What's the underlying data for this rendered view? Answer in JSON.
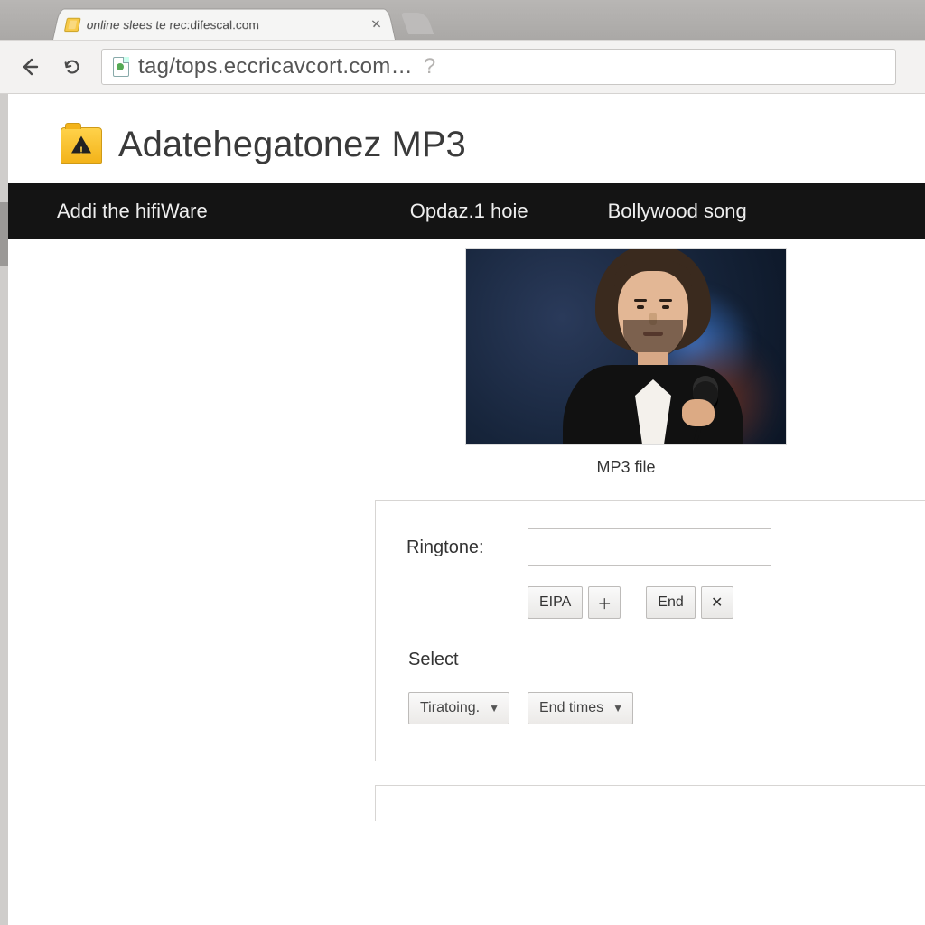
{
  "browser": {
    "tab": {
      "title": "online slees te rec:difescal.com"
    },
    "omnibox": {
      "url": "tag/tops.eccricavcort.com…"
    }
  },
  "page": {
    "title": "Adatehegatonez MP3",
    "nav": {
      "items": [
        "Addi the hifiWare",
        "Opdaz.1 hoie",
        "Bollywood song"
      ]
    },
    "hero": {
      "caption": "MP3 file"
    },
    "form": {
      "ringtone_label": "Ringtone:",
      "ringtone_value": "",
      "eipa_label": "EIPA",
      "end_label": "End",
      "select_label": "Select",
      "combo1_label": "Tiratoing.",
      "combo2_label": "End times"
    }
  }
}
